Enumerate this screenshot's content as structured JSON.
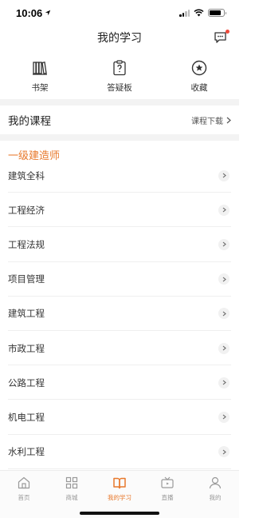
{
  "status": {
    "time": "10:06",
    "location_icon": "location-arrow-icon",
    "signal_icon": "cellular-signal-icon",
    "wifi_icon": "wifi-icon",
    "battery_icon": "battery-icon",
    "battery_level": 0.85
  },
  "nav": {
    "title": "我的学习",
    "message_icon": "message-icon",
    "badge_color": "#f04a3b"
  },
  "quick": [
    {
      "label": "书架",
      "icon": "bookshelf-icon"
    },
    {
      "label": "答疑板",
      "icon": "question-board-icon"
    },
    {
      "label": "收藏",
      "icon": "star-icon"
    }
  ],
  "course_header": {
    "title": "我的课程",
    "download_label": "课程下载"
  },
  "section": {
    "title": "一级建造师",
    "accent": "#e8792c"
  },
  "courses": [
    {
      "name": "建筑全科"
    },
    {
      "name": "工程经济"
    },
    {
      "name": "工程法规"
    },
    {
      "name": "项目管理"
    },
    {
      "name": "建筑工程"
    },
    {
      "name": "市政工程"
    },
    {
      "name": "公路工程"
    },
    {
      "name": "机电工程"
    },
    {
      "name": "水利工程"
    }
  ],
  "tabs": [
    {
      "label": "首页",
      "icon": "home-icon",
      "active": false
    },
    {
      "label": "商城",
      "icon": "grid-icon",
      "active": false
    },
    {
      "label": "我的学习",
      "icon": "open-book-icon",
      "active": true
    },
    {
      "label": "直播",
      "icon": "tv-icon",
      "active": false
    },
    {
      "label": "我的",
      "icon": "user-icon",
      "active": false
    }
  ]
}
